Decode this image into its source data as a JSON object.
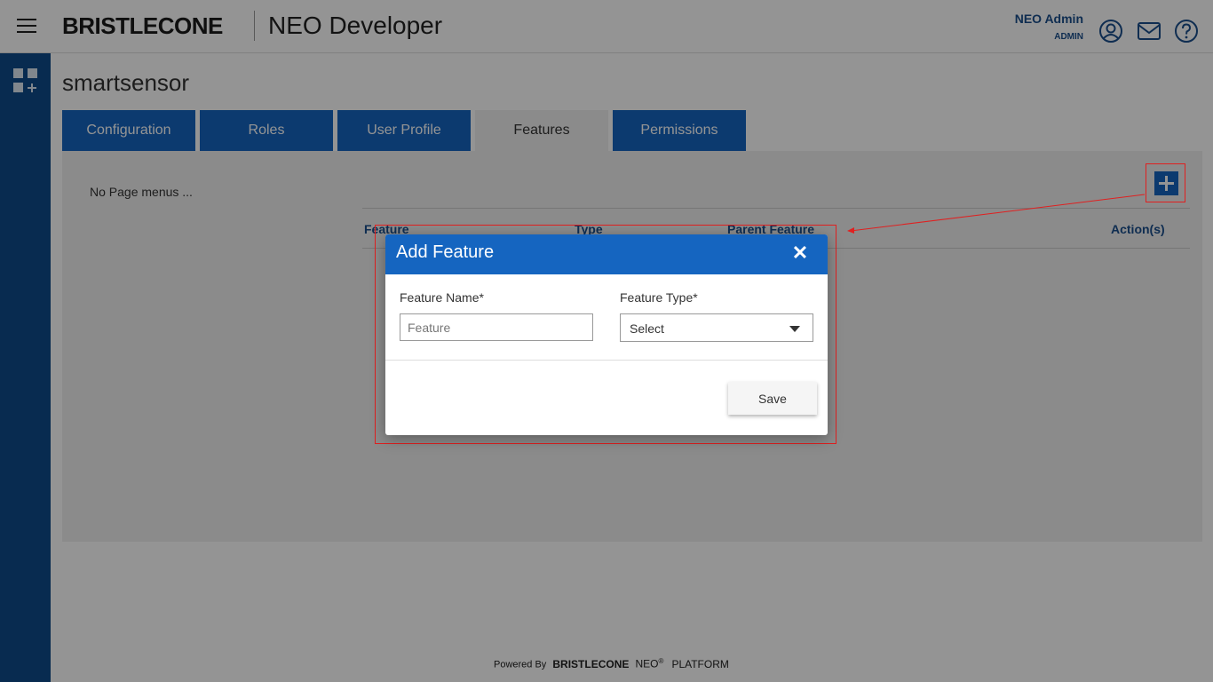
{
  "header": {
    "brand": "BRISTLECONE",
    "app_title": "NEO Developer",
    "user_name": "NEO Admin",
    "user_role": "ADMIN",
    "icons": [
      "menu-icon",
      "user-icon",
      "mail-icon",
      "help-icon"
    ]
  },
  "page": {
    "title": "smartsensor",
    "tabs": [
      {
        "label": "Configuration",
        "active": false
      },
      {
        "label": "Roles",
        "active": false
      },
      {
        "label": "User Profile",
        "active": false
      },
      {
        "label": "Features",
        "active": true
      },
      {
        "label": "Permissions",
        "active": false
      }
    ],
    "empty_menu_text": "No Page menus ...",
    "table_headers": [
      "Feature",
      "Type",
      "Parent Feature",
      "Action(s)"
    ]
  },
  "modal": {
    "title": "Add Feature",
    "feature_name_label": "Feature Name*",
    "feature_name_placeholder": "Feature",
    "feature_type_label": "Feature Type*",
    "feature_type_value": "Select",
    "save_label": "Save"
  },
  "footer": {
    "powered_by": "Powered By",
    "brand": "BRISTLECONE",
    "neo": "NEO",
    "reg": "®",
    "platform": "PLATFORM"
  },
  "colors": {
    "primary": "#1565c0",
    "rail": "#0e4a8a",
    "header_text": "#1a4f8c",
    "highlight": "#e02020"
  }
}
